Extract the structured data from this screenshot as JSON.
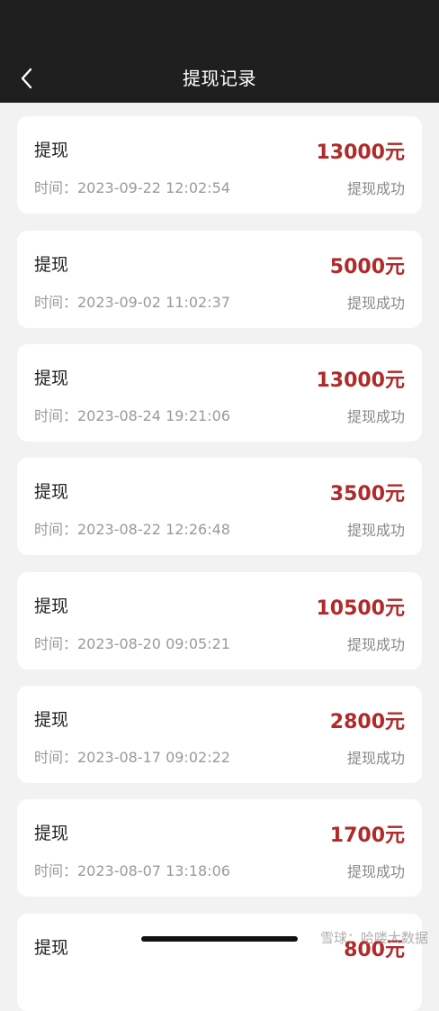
{
  "header": {
    "title": "提现记录",
    "back_icon": "chevron-left-icon"
  },
  "colors": {
    "header_bg": "#1f1f1f",
    "page_bg": "#f2f2f2",
    "amount": "#b02a2a",
    "status": "#888888"
  },
  "records": [
    {
      "type": "提现",
      "amount": "13000元",
      "time": "时间：2023-09-22 12:02:54",
      "status": "提现成功"
    },
    {
      "type": "提现",
      "amount": "5000元",
      "time": "时间：2023-09-02 11:02:37",
      "status": "提现成功"
    },
    {
      "type": "提现",
      "amount": "13000元",
      "time": "时间：2023-08-24 19:21:06",
      "status": "提现成功"
    },
    {
      "type": "提现",
      "amount": "3500元",
      "time": "时间：2023-08-22 12:26:48",
      "status": "提现成功"
    },
    {
      "type": "提现",
      "amount": "10500元",
      "time": "时间：2023-08-20 09:05:21",
      "status": "提现成功"
    },
    {
      "type": "提现",
      "amount": "2800元",
      "time": "时间：2023-08-17 09:02:22",
      "status": "提现成功"
    },
    {
      "type": "提现",
      "amount": "1700元",
      "time": "时间：2023-08-07 13:18:06",
      "status": "提现成功"
    },
    {
      "type": "提现",
      "amount": "800元",
      "time": "",
      "status": ""
    }
  ],
  "watermark": "雪球：哈喽大数据"
}
